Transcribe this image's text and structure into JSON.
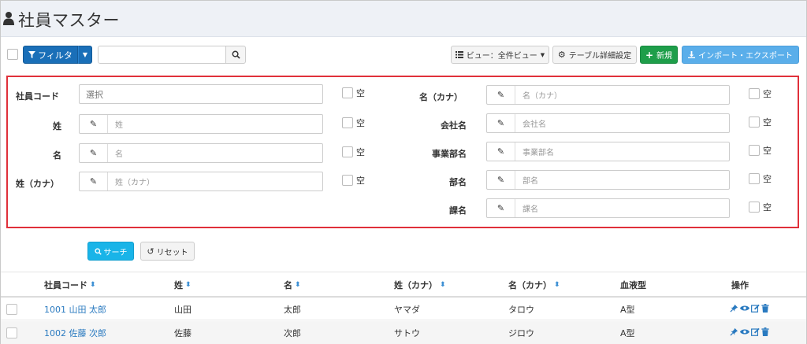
{
  "header": {
    "title": "社員マスター",
    "icon": "user-icon"
  },
  "toolbar": {
    "filter_label": "フィルタ",
    "search_value": "",
    "view_label": "ビュー：全件ビュー",
    "table_settings_label": "テーブル詳細設定",
    "new_label": "新規",
    "import_export_label": "インポート・エクスポート"
  },
  "filter": {
    "left": [
      {
        "label": "社員コード",
        "placeholder": "選択",
        "empty": "空"
      },
      {
        "label": "姓",
        "placeholder": "姓",
        "empty": "空"
      },
      {
        "label": "名",
        "placeholder": "名",
        "empty": "空"
      },
      {
        "label": "姓（カナ）",
        "placeholder": "姓（カナ）",
        "empty": "空"
      }
    ],
    "right": [
      {
        "label": "名（カナ）",
        "placeholder": "名（カナ）",
        "empty": "空"
      },
      {
        "label": "会社名",
        "placeholder": "会社名",
        "empty": "空"
      },
      {
        "label": "事業部名",
        "placeholder": "事業部名",
        "empty": "空"
      },
      {
        "label": "部名",
        "placeholder": "部名",
        "empty": "空"
      },
      {
        "label": "課名",
        "placeholder": "課名",
        "empty": "空"
      }
    ],
    "search_label": "サーチ",
    "reset_label": "リセット"
  },
  "table": {
    "columns": [
      "社員コード",
      "姓",
      "名",
      "姓（カナ）",
      "名（カナ）",
      "血液型",
      "操作"
    ],
    "rows": [
      {
        "code": "1001 山田 太郎",
        "sei": "山田",
        "mei": "太郎",
        "sei_kana": "ヤマダ",
        "mei_kana": "タロウ",
        "blood": "A型"
      },
      {
        "code": "1002 佐藤 次郎",
        "sei": "佐藤",
        "mei": "次郎",
        "sei_kana": "サトウ",
        "mei_kana": "ジロウ",
        "blood": "A型"
      }
    ]
  },
  "colors": {
    "primary": "#1a6fb8",
    "success": "#1e9e4a",
    "info": "#5aaeea",
    "search": "#19b4e8",
    "filter_border": "#e0303a",
    "link": "#2a7ac0"
  }
}
